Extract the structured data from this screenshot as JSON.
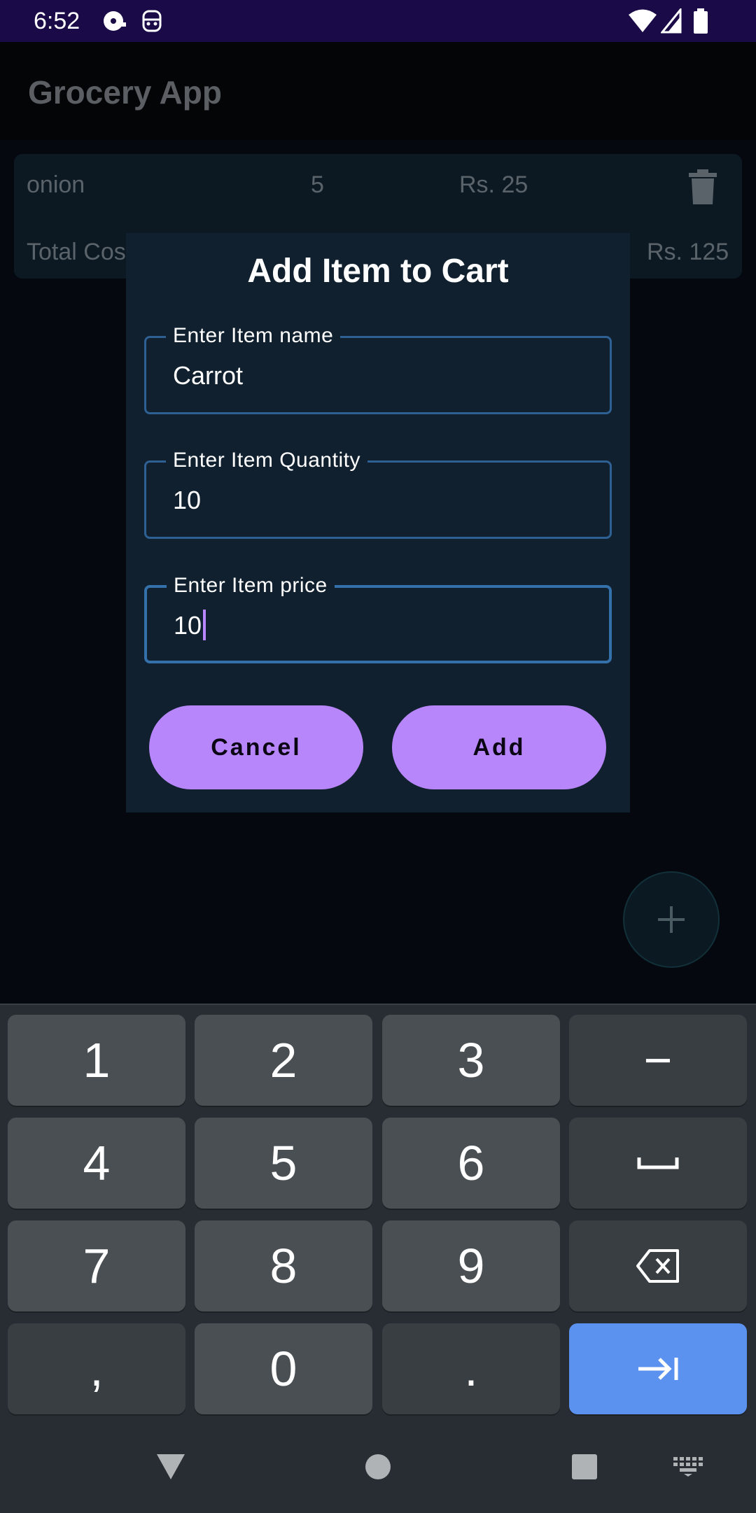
{
  "status_bar": {
    "time": "6:52",
    "icons": [
      "media-icon",
      "privacy-icon",
      "wifi-icon",
      "signal-icon",
      "battery-icon"
    ]
  },
  "app_bar": {
    "title": "Grocery App"
  },
  "cart_list": {
    "items": [
      {
        "name": "onion",
        "quantity": "5",
        "price": "Rs. 25"
      }
    ],
    "total_label": "Total Cos",
    "total_value": "Rs. 125"
  },
  "dialog": {
    "title": "Add Item to Cart",
    "fields": [
      {
        "label": "Enter Item name",
        "value": "Carrot"
      },
      {
        "label": "Enter Item Quantity",
        "value": "10"
      },
      {
        "label": "Enter Item price",
        "value": "10"
      }
    ],
    "cancel_label": "Cancel",
    "add_label": "Add"
  },
  "keyboard": {
    "keys": [
      "1",
      "2",
      "3",
      "−",
      "4",
      "5",
      "6",
      "␣",
      "7",
      "8",
      "9",
      "⌫",
      ",",
      "0",
      ".",
      "⇥"
    ]
  },
  "colors": {
    "accent": "#b886fb",
    "field_border": "#2e6094",
    "dialog_bg": "#10202f",
    "enter_key": "#5b92ef"
  }
}
